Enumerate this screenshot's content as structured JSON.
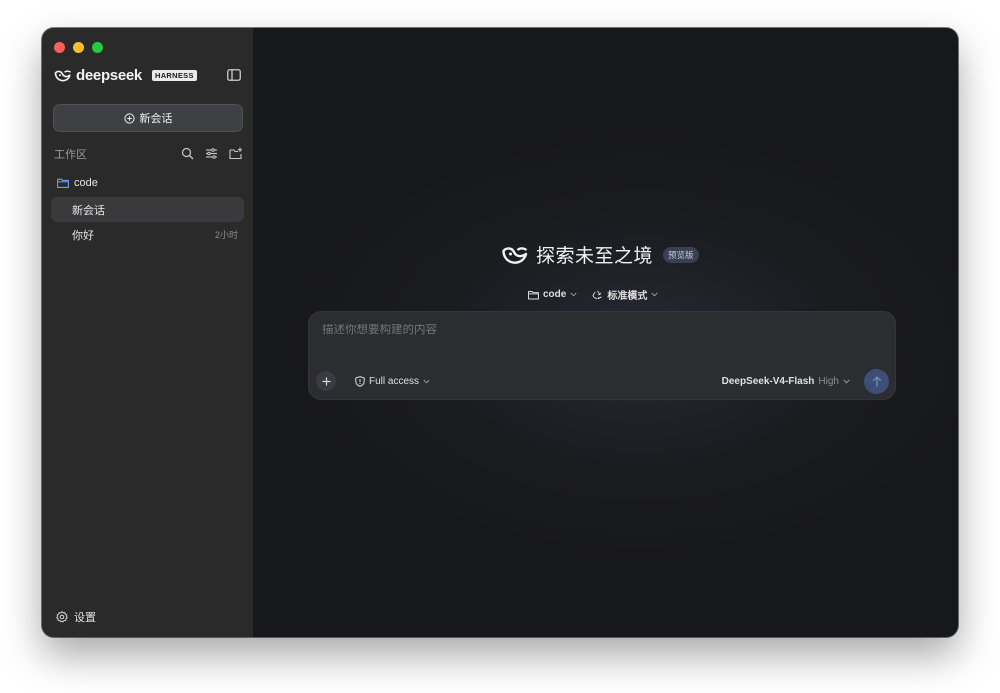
{
  "sidebar": {
    "brand_name": "deepseek",
    "brand_badge": "HARNESS",
    "new_chat_label": "新会话",
    "workspace_title": "工作区",
    "folder_label": "code",
    "conversations": [
      {
        "label": "新会话",
        "time": "",
        "active": true
      },
      {
        "label": "你好",
        "time": "2小时",
        "active": false
      }
    ],
    "settings_label": "设置"
  },
  "main": {
    "hero_title": "探索未至之境",
    "hero_badge": "预览版",
    "folder_selector": "code",
    "mode_selector": "标准模式",
    "input_placeholder": "描述你想要构建的内容",
    "access_label": "Full access",
    "model_name": "DeepSeek-V4-Flash",
    "model_level": "High"
  },
  "colors": {
    "accent_folder": "#6b9cff",
    "send_button": "#3d4f78",
    "sidebar_bg": "#2a2a2b",
    "main_bg": "#18191c"
  },
  "icons": [
    "close-dot",
    "minimize-dot",
    "zoom-dot",
    "deepseek-whale-logo",
    "sidebar-toggle-icon",
    "plus-circle-icon",
    "search-icon",
    "filter-icon",
    "new-folder-icon",
    "folder-icon",
    "gear-icon",
    "chevron-down-icon",
    "recycle-icon",
    "plus-icon",
    "shield-icon",
    "arrow-up-icon"
  ]
}
